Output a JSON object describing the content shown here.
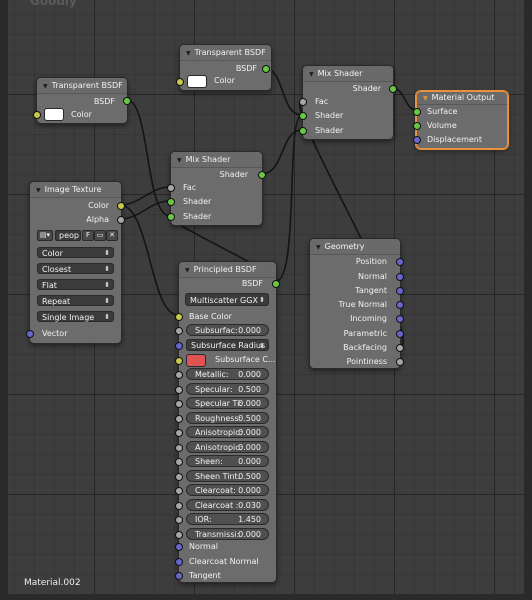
{
  "bg_ghost_text": "Goodly",
  "material_name": "Material.002",
  "colors": {
    "shader_socket": "#68c846",
    "color_socket": "#c8c84a",
    "float_socket": "#a6a6a6",
    "vector_socket": "#6666cc",
    "active_outline": "#e8933c",
    "subsurface_color": "#e05353",
    "white_swatch": "#ffffff"
  },
  "nodes": {
    "transparent1": {
      "title": "Transparent BSDF",
      "output_bsdf": "BSDF",
      "input_color": "Color"
    },
    "transparent2": {
      "title": "Transparent BSDF",
      "output_bsdf": "BSDF",
      "input_color": "Color"
    },
    "mix1": {
      "title": "Mix Shader",
      "output_shader": "Shader",
      "input_fac": "Fac",
      "input_shader1": "Shader",
      "input_shader2": "Shader"
    },
    "mix2": {
      "title": "Mix Shader",
      "output_shader": "Shader",
      "input_fac": "Fac",
      "input_shader1": "Shader",
      "input_shader2": "Shader"
    },
    "output": {
      "title": "Material Output",
      "input_surface": "Surface",
      "input_volume": "Volume",
      "input_displacement": "Displacement"
    },
    "image": {
      "title": "Image Texture",
      "output_color": "Color",
      "output_alpha": "Alpha",
      "image_name": "peop",
      "fake_user": "F",
      "dropdowns": [
        "Color",
        "Closest",
        "Flat",
        "Repeat",
        "Single Image"
      ],
      "input_vector": "Vector"
    },
    "geometry": {
      "title": "Geometry",
      "outputs": [
        "Position",
        "Normal",
        "Tangent",
        "True Normal",
        "Incoming",
        "Parametric",
        "Backfacing",
        "Pointiness"
      ]
    },
    "principled": {
      "title": "Principled BSDF",
      "output_bsdf": "BSDF",
      "distribution": "Multiscatter GGX",
      "input_base_color": "Base Color",
      "subsurface": {
        "label": "Subsurfac:",
        "value": "0.000"
      },
      "subsurface_radius": "Subsurface Radius",
      "subsurface_color": "Subsurface C...",
      "fields": [
        {
          "label": "Metallic:",
          "value": "0.000"
        },
        {
          "label": "Specular:",
          "value": "0.500"
        },
        {
          "label": "Specular Ti:",
          "value": "0.000"
        },
        {
          "label": "Roughness:",
          "value": "0.500"
        },
        {
          "label": "Anisotropic:",
          "value": "0.000"
        },
        {
          "label": "Anisotropic:",
          "value": "0.000"
        },
        {
          "label": "Sheen:",
          "value": "0.000"
        },
        {
          "label": "Sheen Tint:",
          "value": "0.500"
        },
        {
          "label": "Clearcoat:",
          "value": "0.000"
        },
        {
          "label": "Clearcoat :",
          "value": "0.030"
        },
        {
          "label": "IOR:",
          "value": "1.450"
        },
        {
          "label": "Transmissi:",
          "value": "0.000"
        }
      ],
      "input_normal": "Normal",
      "input_clearcoat_normal": "Clearcoat Normal",
      "input_tangent": "Tangent"
    }
  }
}
